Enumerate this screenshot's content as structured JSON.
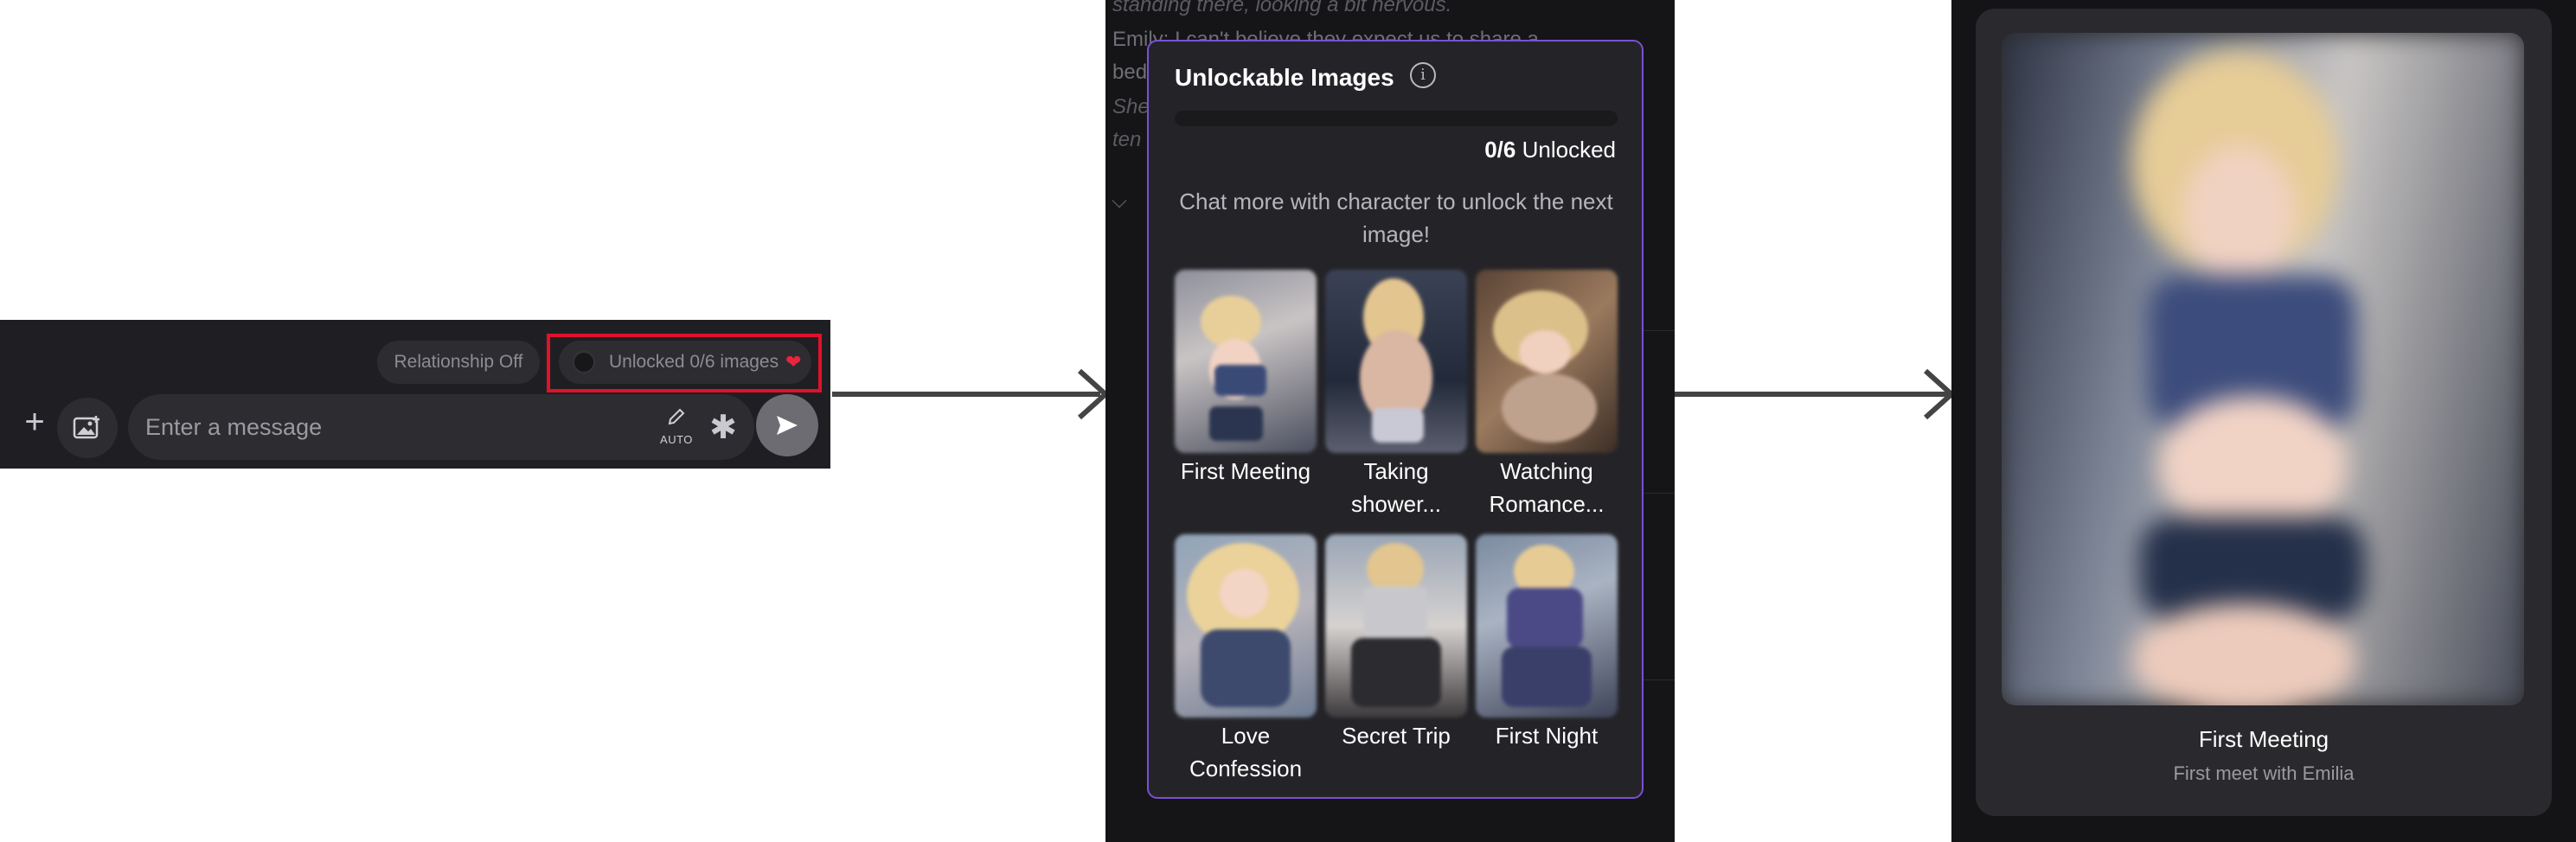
{
  "chat_bar": {
    "relationship_toggle_label": "Relationship Off",
    "unlocked_label": "Unlocked 0/6 images",
    "heart": "❤",
    "message_placeholder": "Enter a message",
    "auto_label": "AUTO",
    "plus_icon": "+",
    "star_icon": "✱",
    "colors": {
      "highlight_border": "#e0112b",
      "background": "#1f1f23"
    }
  },
  "modal": {
    "title": "Unlockable Images",
    "info_icon": "i",
    "progress": 0,
    "unlocked_count": "0/6",
    "unlocked_suffix": " Unlocked",
    "hint": "Chat more with character to unlock the next image!",
    "accent_color": "#7b4fd6",
    "images": [
      {
        "title": "First Meeting"
      },
      {
        "title": "Taking shower..."
      },
      {
        "title": "Watching Romance..."
      },
      {
        "title": "Love Confession"
      },
      {
        "title": "Secret Trip"
      },
      {
        "title": "First Night"
      }
    ],
    "background_snippets": [
      "standing there, looking a bit nervous.",
      "Emily: I can't believe they expect us to share a",
      "bed",
      "She",
      "ten"
    ]
  },
  "detail_card": {
    "title": "First Meeting",
    "subtitle": "First meet with Emilia"
  }
}
